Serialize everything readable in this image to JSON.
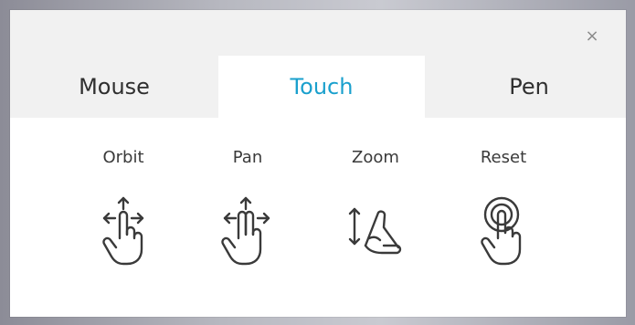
{
  "dialog": {
    "close_symbol": "×",
    "tabs": [
      {
        "label": "Mouse",
        "active": false
      },
      {
        "label": "Touch",
        "active": true
      },
      {
        "label": "Pen",
        "active": false
      }
    ],
    "gestures": [
      {
        "label": "Orbit",
        "icon": "one-finger-drag-icon"
      },
      {
        "label": "Pan",
        "icon": "two-finger-drag-icon"
      },
      {
        "label": "Zoom",
        "icon": "pinch-zoom-icon"
      },
      {
        "label": "Reset",
        "icon": "tap-icon"
      }
    ]
  },
  "colors": {
    "accent": "#1aa0cd",
    "tab_bar": "#f1f1f1",
    "text": "#2f2f2f",
    "icon": "#3a3a3a"
  }
}
